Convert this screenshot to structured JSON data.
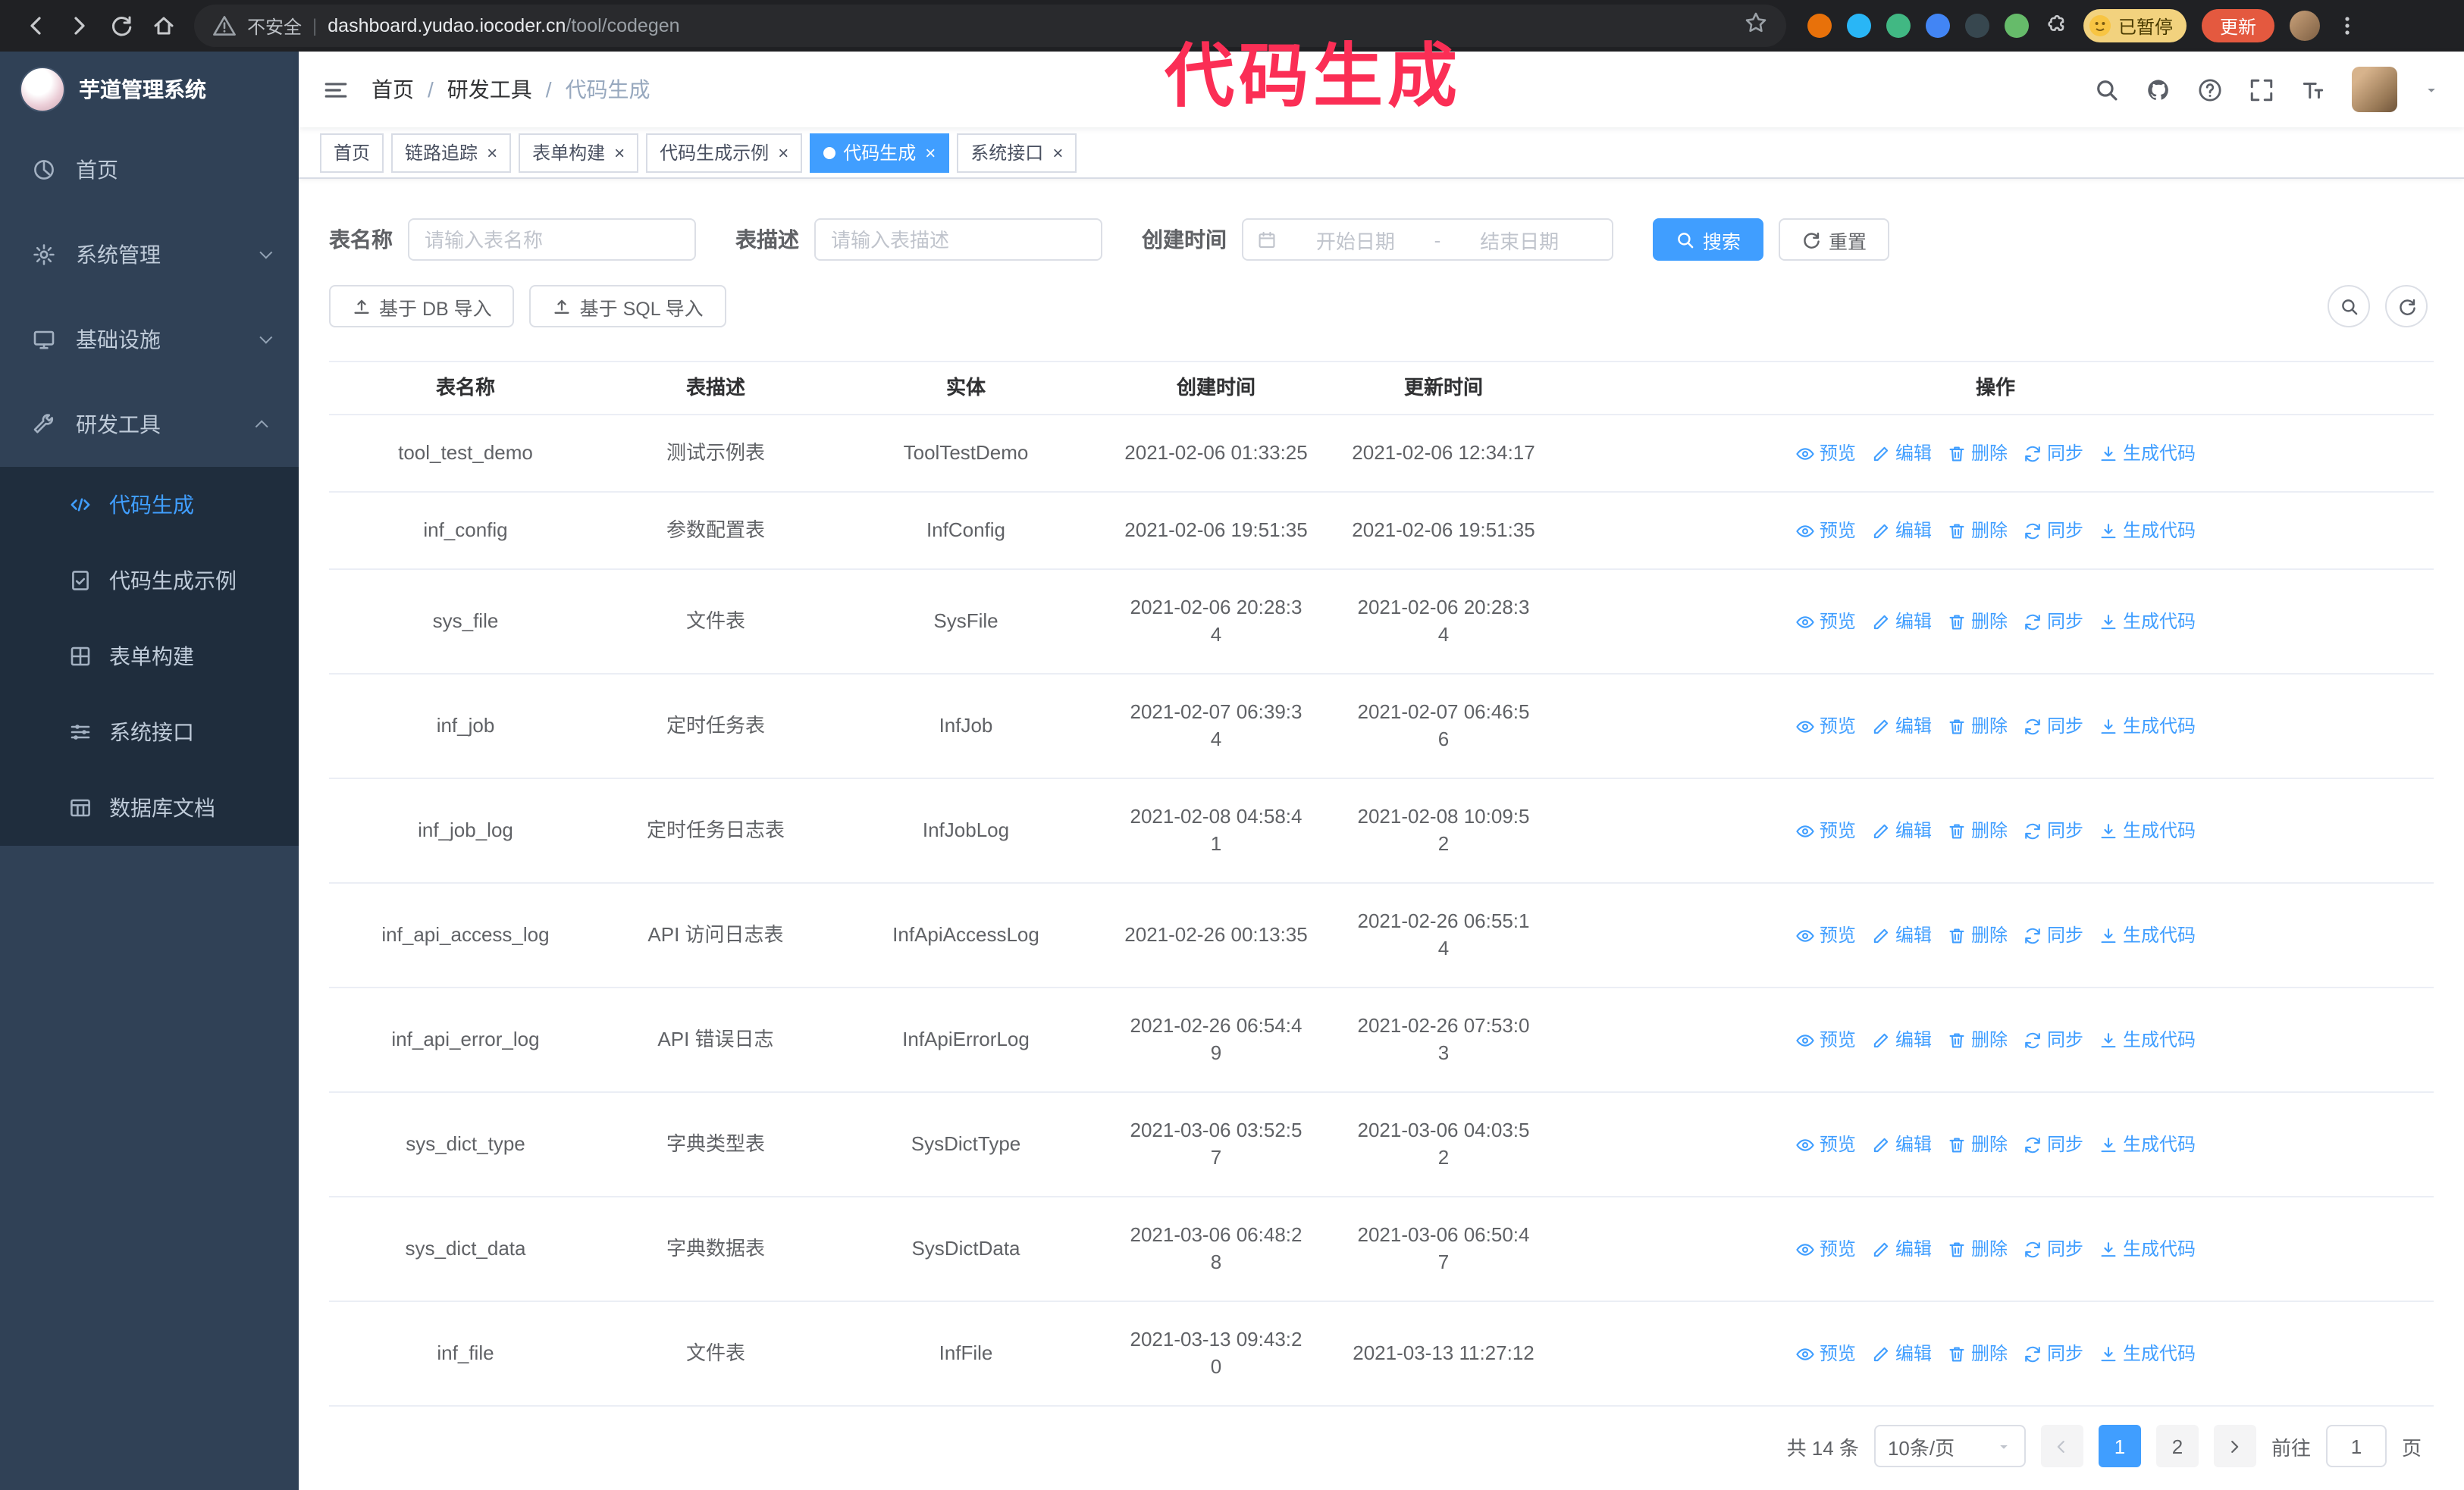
{
  "browser": {
    "security_text": "不安全",
    "url_host": "dashboard.yudao.iocoder.cn",
    "url_path": "/tool/codegen",
    "paused_badge": "已暂停",
    "update_button": "更新"
  },
  "annotation": "代码生成",
  "sidebar": {
    "logo_title": "芋道管理系统",
    "items": [
      {
        "label": "首页",
        "icon": "dashboard-icon"
      },
      {
        "label": "系统管理",
        "icon": "gear-icon",
        "expanded": false
      },
      {
        "label": "基础设施",
        "icon": "monitor-icon",
        "expanded": false
      },
      {
        "label": "研发工具",
        "icon": "tools-icon",
        "expanded": true
      }
    ],
    "submenu": [
      {
        "label": "代码生成",
        "icon": "code-icon",
        "active": true
      },
      {
        "label": "代码生成示例",
        "icon": "doc-check-icon",
        "active": false
      },
      {
        "label": "表单构建",
        "icon": "grid-icon",
        "active": false
      },
      {
        "label": "系统接口",
        "icon": "sliders-icon",
        "active": false
      },
      {
        "label": "数据库文档",
        "icon": "table-icon",
        "active": false
      }
    ]
  },
  "header": {
    "breadcrumb": [
      "首页",
      "研发工具",
      "代码生成"
    ],
    "breadcrumb_separator": "/"
  },
  "tabs": [
    {
      "label": "首页",
      "closable": false,
      "active": false
    },
    {
      "label": "链路追踪",
      "closable": true,
      "active": false
    },
    {
      "label": "表单构建",
      "closable": true,
      "active": false
    },
    {
      "label": "代码生成示例",
      "closable": true,
      "active": false
    },
    {
      "label": "代码生成",
      "closable": true,
      "active": true
    },
    {
      "label": "系统接口",
      "closable": true,
      "active": false
    }
  ],
  "filters": {
    "table_name_label": "表名称",
    "table_name_placeholder": "请输入表名称",
    "table_desc_label": "表描述",
    "table_desc_placeholder": "请输入表描述",
    "create_time_label": "创建时间",
    "date_start_placeholder": "开始日期",
    "date_separator": "-",
    "date_end_placeholder": "结束日期",
    "search_button": "搜索",
    "reset_button": "重置"
  },
  "toolbar": {
    "import_db": "基于 DB 导入",
    "import_sql": "基于 SQL 导入"
  },
  "table": {
    "columns": [
      "表名称",
      "表描述",
      "实体",
      "创建时间",
      "更新时间",
      "操作"
    ],
    "actions": [
      "预览",
      "编辑",
      "删除",
      "同步",
      "生成代码"
    ],
    "rows": [
      {
        "name": "tool_test_demo",
        "desc": "测试示例表",
        "entity": "ToolTestDemo",
        "created": "2021-02-06 01:33:25",
        "created_wrap": false,
        "updated": "2021-02-06 12:34:17",
        "updated_wrap": false
      },
      {
        "name": "inf_config",
        "desc": "参数配置表",
        "entity": "InfConfig",
        "created": "2021-02-06 19:51:35",
        "created_wrap": false,
        "updated": "2021-02-06 19:51:35",
        "updated_wrap": false
      },
      {
        "name": "sys_file",
        "desc": "文件表",
        "entity": "SysFile",
        "created": "2021-02-06 20:28:34",
        "created_wrap": true,
        "updated": "2021-02-06 20:28:34",
        "updated_wrap": true
      },
      {
        "name": "inf_job",
        "desc": "定时任务表",
        "entity": "InfJob",
        "created": "2021-02-07 06:39:34",
        "created_wrap": true,
        "updated": "2021-02-07 06:46:56",
        "updated_wrap": true
      },
      {
        "name": "inf_job_log",
        "desc": "定时任务日志表",
        "entity": "InfJobLog",
        "created": "2021-02-08 04:58:41",
        "created_wrap": true,
        "updated": "2021-02-08 10:09:52",
        "updated_wrap": true
      },
      {
        "name": "inf_api_access_log",
        "desc": "API 访问日志表",
        "entity": "InfApiAccessLog",
        "created": "2021-02-26 00:13:35",
        "created_wrap": false,
        "updated": "2021-02-26 06:55:14",
        "updated_wrap": true
      },
      {
        "name": "inf_api_error_log",
        "desc": "API 错误日志",
        "entity": "InfApiErrorLog",
        "created": "2021-02-26 06:54:49",
        "created_wrap": true,
        "updated": "2021-02-26 07:53:03",
        "updated_wrap": true
      },
      {
        "name": "sys_dict_type",
        "desc": "字典类型表",
        "entity": "SysDictType",
        "created": "2021-03-06 03:52:57",
        "created_wrap": true,
        "updated": "2021-03-06 04:03:52",
        "updated_wrap": true
      },
      {
        "name": "sys_dict_data",
        "desc": "字典数据表",
        "entity": "SysDictData",
        "created": "2021-03-06 06:48:28",
        "created_wrap": true,
        "updated": "2021-03-06 06:50:47",
        "updated_wrap": true
      },
      {
        "name": "inf_file",
        "desc": "文件表",
        "entity": "InfFile",
        "created": "2021-03-13 09:43:20",
        "created_wrap": true,
        "updated": "2021-03-13 11:27:12",
        "updated_wrap": false
      }
    ]
  },
  "pagination": {
    "total_text": "共 14 条",
    "page_size": "10条/页",
    "pages": [
      "1",
      "2"
    ],
    "active_page": "1",
    "goto_label": "前往",
    "goto_value": "1",
    "goto_suffix": "页"
  }
}
